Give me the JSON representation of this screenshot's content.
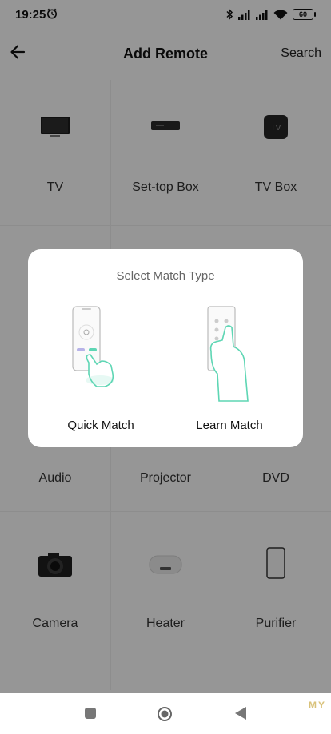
{
  "status_bar": {
    "time": "19:25",
    "battery": "60"
  },
  "header": {
    "title": "Add Remote",
    "search_label": "Search"
  },
  "devices": [
    {
      "label": "TV",
      "icon": "tv-icon"
    },
    {
      "label": "Set-top Box",
      "icon": "set-top-box-icon"
    },
    {
      "label": "TV Box",
      "icon": "tv-box-icon"
    },
    {
      "label": "Audio",
      "icon": "audio-icon"
    },
    {
      "label": "Projector",
      "icon": "projector-icon"
    },
    {
      "label": "DVD",
      "icon": "dvd-icon"
    },
    {
      "label": "Camera",
      "icon": "camera-icon"
    },
    {
      "label": "Heater",
      "icon": "heater-icon"
    },
    {
      "label": "Purifier",
      "icon": "purifier-icon"
    }
  ],
  "dialog": {
    "title": "Select Match Type",
    "options": [
      {
        "label": "Quick Match",
        "icon": "quick-match-phone-hand-icon"
      },
      {
        "label": "Learn Match",
        "icon": "learn-match-remote-hand-icon"
      }
    ]
  },
  "watermark": "MY",
  "colors": {
    "accent": "#5ed6b4",
    "overlay": "#000000"
  }
}
